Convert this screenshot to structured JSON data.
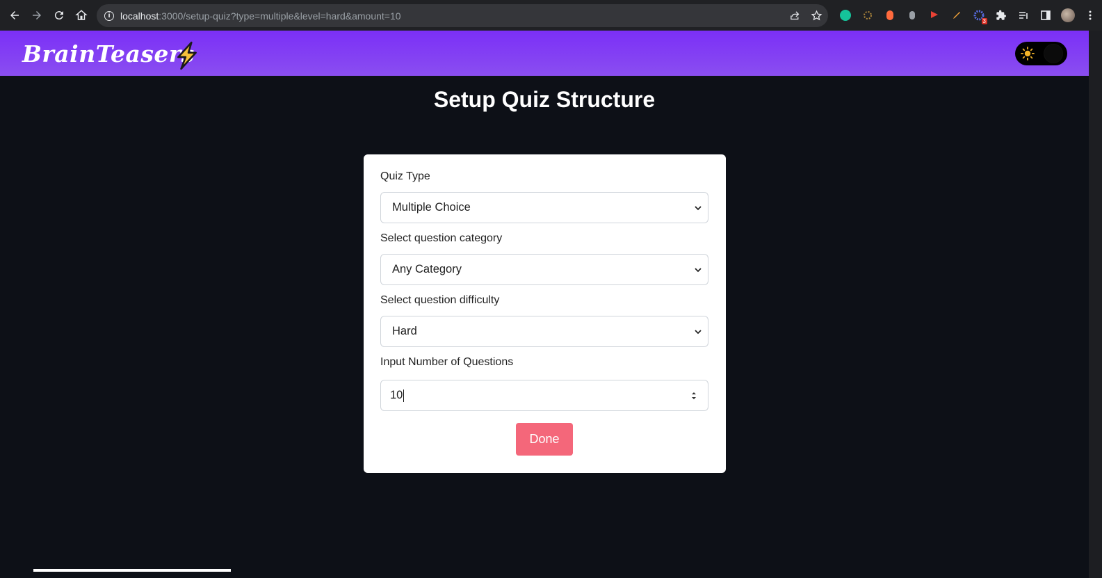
{
  "browser": {
    "url_host": "localhost",
    "url_rest": ":3000/setup-quiz?type=multiple&level=hard&amount=10",
    "extension_badge": "3"
  },
  "app": {
    "brand": "BrainTeasers",
    "theme_toggle_state": "dark"
  },
  "page": {
    "title": "Setup Quiz Structure"
  },
  "form": {
    "quiz_type_label": "Quiz Type",
    "quiz_type_value": "Multiple Choice",
    "category_label": "Select question category",
    "category_value": "Any Category",
    "difficulty_label": "Select question difficulty",
    "difficulty_value": "Hard",
    "amount_label": "Input Number of Questions",
    "amount_value": "10",
    "done_label": "Done"
  },
  "colors": {
    "header_start": "#7b2ff7",
    "header_end": "#8a4ef0",
    "page_bg": "#0d1017",
    "done_button": "#f4677a"
  }
}
